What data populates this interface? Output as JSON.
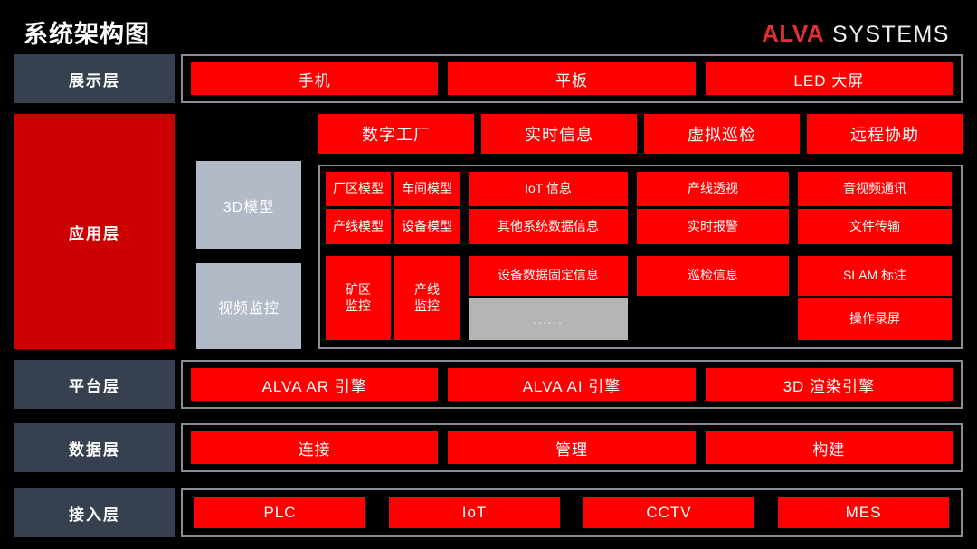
{
  "header": {
    "title": "系统架构图",
    "logo_mark": "ALVA",
    "logo_word": "SYSTEMS",
    "logo_mark_color": "#e03030",
    "logo_word_color": "#eceef0"
  },
  "colors": {
    "background": "#000000",
    "layer_label": "#36404f",
    "layer_label_accent": "#cc0000",
    "card": "#ff0000",
    "gray_box": "#b2b9c7",
    "placeholder": "#b5b5b5",
    "panel_border": "#868d96"
  },
  "layers": {
    "presentation": {
      "label": "展示层",
      "cards": [
        "手机",
        "平板",
        "LED 大屏"
      ]
    },
    "application": {
      "label": "应用层",
      "gray_boxes": [
        "3D模型",
        "视频监控"
      ],
      "top_cards": [
        "数字工厂",
        "实时信息",
        "虚拟巡检",
        "远程协助"
      ],
      "grid": {
        "model_column": [
          "厂区模型",
          "车间模型",
          "产线模型",
          "设备模型"
        ],
        "monitor_column": [
          "矿区\n监控",
          "产线\n监控"
        ],
        "info_column_top": [
          "IoT 信息",
          "其他系统数据信息"
        ],
        "info_column_bottom": [
          "设备数据固定信息"
        ],
        "info_placeholder": "......",
        "inspect_column_top": [
          "产线透视",
          "实时报警"
        ],
        "inspect_column_bottom": [
          "巡检信息"
        ],
        "remote_column_top": [
          "音视频通讯",
          "文件传输"
        ],
        "remote_column_bottom": [
          "SLAM 标注",
          "操作录屏"
        ]
      }
    },
    "platform": {
      "label": "平台层",
      "cards": [
        "ALVA AR 引擎",
        "ALVA AI 引擎",
        "3D 渲染引擎"
      ]
    },
    "data": {
      "label": "数据层",
      "cards": [
        "连接",
        "管理",
        "构建"
      ]
    },
    "access": {
      "label": "接入层",
      "cards": [
        "PLC",
        "IoT",
        "CCTV",
        "MES"
      ]
    }
  }
}
